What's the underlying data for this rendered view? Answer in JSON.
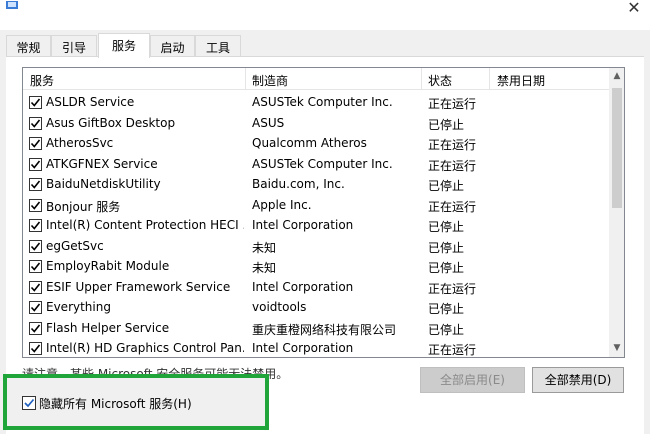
{
  "dialog": {
    "tabs": [
      {
        "label": "常规"
      },
      {
        "label": "引导"
      },
      {
        "label": "服务",
        "active": true
      },
      {
        "label": "启动"
      },
      {
        "label": "工具"
      }
    ],
    "columns": {
      "service": "服务",
      "manufacturer": "制造商",
      "status": "状态",
      "disabled_date": "禁用日期"
    },
    "services": [
      {
        "name": "ASLDR Service",
        "manufacturer": "ASUSTek Computer Inc.",
        "status": "正在运行",
        "checked": true
      },
      {
        "name": "Asus GiftBox Desktop",
        "manufacturer": "ASUS",
        "status": "已停止",
        "checked": true
      },
      {
        "name": "AtherosSvc",
        "manufacturer": "Qualcomm Atheros",
        "status": "正在运行",
        "checked": true
      },
      {
        "name": "ATKGFNEX Service",
        "manufacturer": "ASUSTek Computer Inc.",
        "status": "正在运行",
        "checked": true
      },
      {
        "name": "BaiduNetdiskUtility",
        "manufacturer": "Baidu.com, Inc.",
        "status": "已停止",
        "checked": true
      },
      {
        "name": "Bonjour 服务",
        "manufacturer": "Apple Inc.",
        "status": "正在运行",
        "checked": true
      },
      {
        "name": "Intel(R) Content Protection HECI ...",
        "manufacturer": "Intel Corporation",
        "status": "已停止",
        "checked": true
      },
      {
        "name": "egGetSvc",
        "manufacturer": "未知",
        "status": "已停止",
        "checked": true
      },
      {
        "name": "EmployRabit Module",
        "manufacturer": "未知",
        "status": "已停止",
        "checked": true
      },
      {
        "name": "ESIF Upper Framework Service",
        "manufacturer": "Intel Corporation",
        "status": "正在运行",
        "checked": true
      },
      {
        "name": "Everything",
        "manufacturer": "voidtools",
        "status": "已停止",
        "checked": true
      },
      {
        "name": "Flash Helper Service",
        "manufacturer": "重庆重橙网络科技有限公司",
        "status": "已停止",
        "checked": true
      },
      {
        "name": "Intel(R) HD Graphics Control Pan...",
        "manufacturer": "Intel Corporation",
        "status": "正在运行",
        "checked": true
      }
    ],
    "note": "请注意，某些 Microsoft 安全服务可能无法禁用。",
    "enable_all_label": "全部启用(E)",
    "disable_all_label": "全部禁用(D)",
    "hide_ms_label": "隐藏所有 Microsoft 服务(H)",
    "hide_ms_checked": true,
    "accent": "#1fa53a"
  }
}
